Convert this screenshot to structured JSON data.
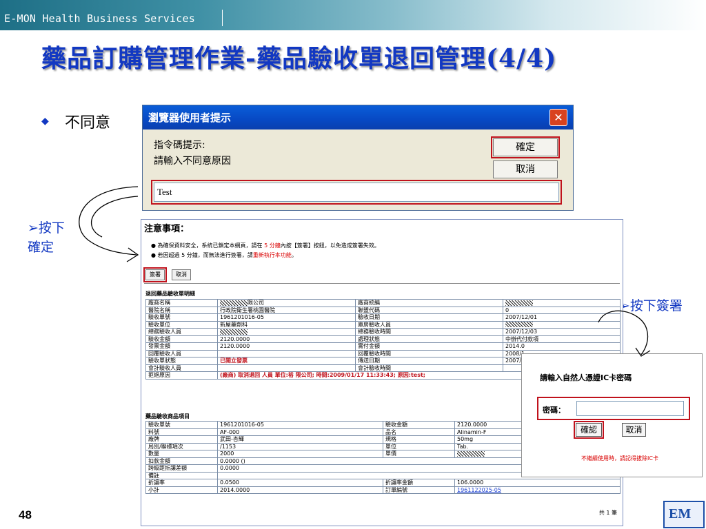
{
  "header": {
    "company": "E-MON Health Business Services",
    "page_number": "48",
    "logo_text": "EM"
  },
  "slide": {
    "title": "藥品訂購管理作業-藥品驗收單退回管理(4/4)",
    "bullet_mark": "◆",
    "bullet": "不同意",
    "note_left_line1": "➢按下",
    "note_left_line2": "確定",
    "note_right": "➢按下簽署"
  },
  "dialog": {
    "title": "瀏覽器使用者提示",
    "close_glyph": "✕",
    "message_line1": "指令碼提示:",
    "message_line2": "請輸入不同意原因",
    "ok_label": "確定",
    "cancel_label": "取消",
    "input_value": "Test"
  },
  "page": {
    "heading": "注意事項：",
    "line1_prefix": "● 為確保資料安全，系統已鎖定本網頁，請在 ",
    "line1_red": "5 分鐘",
    "line1_suffix": "內按【簽署】按鈕，以免造成簽署失效。",
    "line2_prefix": "● 若因超過 5 分鐘，而無法進行簽署，請",
    "line2_red": "重新執行本功能",
    "line2_suffix": "。",
    "sign_label": "簽署",
    "cancel_label": "取消",
    "section1_title": "退回藥品驗收單明細",
    "section2_title": "藥品驗收商品項目",
    "footer_count": "共 1 筆",
    "t1": {
      "r1": [
        "廠商名稱",
        "限公司",
        "廠商統編",
        ""
      ],
      "r2": [
        "醫院名稱",
        "行政院衛生署桃園醫院",
        "聯盟代碼",
        "0"
      ],
      "r3": [
        "驗收單號",
        "1961201016-05",
        "驗收日期",
        "2007/12/01"
      ],
      "r4": [
        "驗收單位",
        "新屋藥劑科",
        "庫房驗收人員",
        ""
      ],
      "r5": [
        "總務驗收人員",
        "",
        "總務驗收時間",
        "2007/12/03"
      ],
      "r6": [
        "驗收金額",
        "2120.0000",
        "處理狀態",
        "中辦代付款項"
      ],
      "r7": [
        "發票金額",
        "2120.0000",
        "實付金額",
        "2014.0"
      ],
      "r8": [
        "回覆驗收人員",
        "",
        "回覆驗收時間",
        "2008/1"
      ],
      "r9": [
        "驗收單狀態",
        "已開立發票",
        "傳送日期",
        "2007/1"
      ],
      "r10": [
        "會計驗收人員",
        "",
        "會計驗收時間",
        ""
      ],
      "reason_label": "拒絕原因",
      "reason_value": "(廠商) 取消退回 人員     單位:裕      限公司; 時間:2009/01/17 11:33:43; 原因:test;"
    },
    "t2": {
      "r1": [
        "驗收單號",
        "1961201016-05",
        "驗收金額",
        "2120.0000"
      ],
      "r2": [
        "料號",
        "AF-000",
        "品名",
        "Alinamin-F"
      ],
      "r3": [
        "廠牌",
        "武田-杏輝",
        "規格",
        "50mg"
      ],
      "r4": [
        "局別/聯標項次",
        "/1153",
        "單位",
        "Tab."
      ],
      "r5": [
        "數量",
        "2000",
        "單價",
        ""
      ],
      "r6": [
        "扣款金額",
        "0.0000 ()"
      ],
      "r7": [
        "跨級距折讓差額",
        "0.0000"
      ],
      "r8": [
        "備註",
        ""
      ],
      "r9": [
        "折讓率",
        "0.0500",
        "折讓率金額",
        "106.0000"
      ],
      "r10": [
        "小計",
        "2014.0000",
        "訂單編號",
        "1961122025-05"
      ]
    }
  },
  "ic_box": {
    "title": "請輸入自然人憑證IC卡密碼",
    "password_label": "密碼：",
    "password_value": "",
    "ok_label": "確認",
    "cancel_label": "取消",
    "warning": "不繼續使用時，請記得拔除IC卡"
  },
  "colors": {
    "title_blue": "#1238c2",
    "highlight_red": "#c0121c",
    "dialog_titlebar": "#0749c4"
  }
}
